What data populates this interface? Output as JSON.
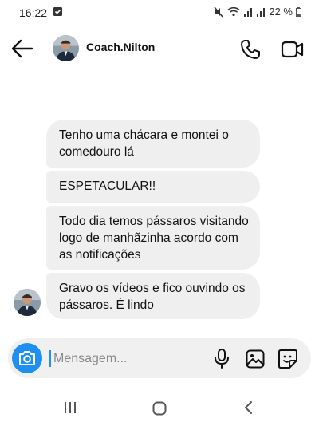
{
  "status_bar": {
    "time": "16:22",
    "battery": "22 %",
    "icons": [
      "notification-check-icon",
      "mute-icon",
      "wifi-icon",
      "signal-icon",
      "signal-icon",
      "battery-icon"
    ]
  },
  "header": {
    "contact_name": "Coach.Nilton",
    "icons": [
      "back-arrow-icon",
      "avatar",
      "phone-icon",
      "video-camera-icon"
    ]
  },
  "messages": [
    {
      "text": "Tenho uma chácara e montei o comedouro lá"
    },
    {
      "text": "ESPETACULAR!!"
    },
    {
      "text": "Todo dia temos pássaros visitando logo de manhãzinha acordo com as notificações"
    },
    {
      "text": "Gravo os vídeos e fico ouvindo os pássaros. É lindo"
    }
  ],
  "composer": {
    "placeholder": "Mensagem...",
    "value": "",
    "icons": [
      "camera-icon",
      "microphone-icon",
      "gallery-icon",
      "sticker-icon"
    ]
  },
  "colors": {
    "accent": "#1f8ff2",
    "bubble": "#efefef",
    "composer_bg": "#f0f0f0"
  },
  "navbar": {
    "icons": [
      "recents-icon",
      "home-icon",
      "back-icon"
    ]
  }
}
